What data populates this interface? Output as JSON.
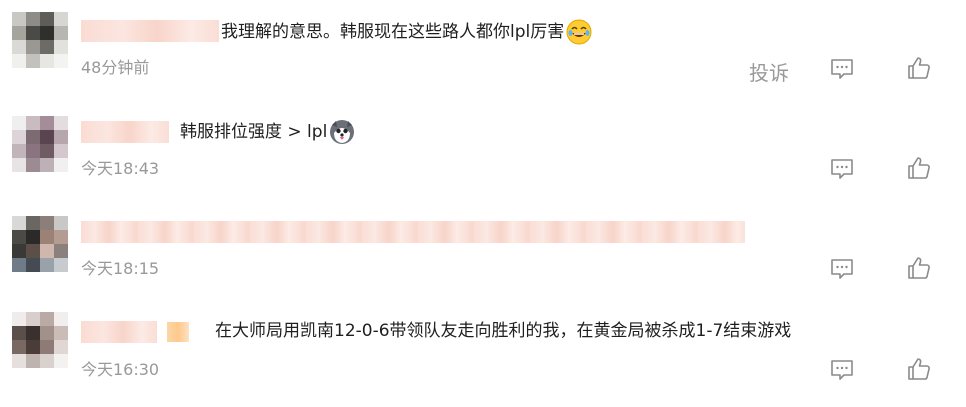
{
  "comments": [
    {
      "text": "我理解的意思。韩服现在这些路人都你lpl厉害",
      "emoji": "laughing-tears-emoji",
      "time": "48分钟前",
      "report_label": "投诉"
    },
    {
      "text": "韩服排位强度 > lpl",
      "emoji": "husky-tongue-emoji",
      "time": "今天18:43"
    },
    {
      "text": "",
      "time": "今天18:15"
    },
    {
      "text": "在大师局用凯南12-0-6带领队友走向胜利的我，在黄金局被杀成1-7结束游戏",
      "time": "今天16:30"
    }
  ],
  "colors": {
    "text": "#1f1f1f",
    "meta": "#999999",
    "icon": "#8a8a8a",
    "blurred_name": "#f9d8cf"
  },
  "icons": {
    "reply": "comment-bubble-icon",
    "like": "thumbs-up-icon"
  }
}
